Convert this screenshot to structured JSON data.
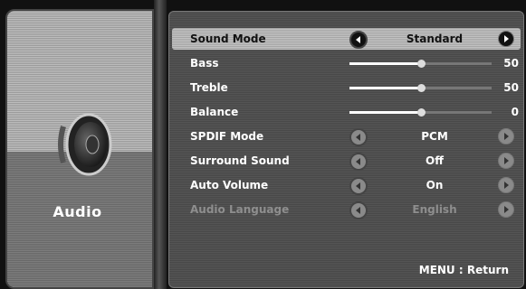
{
  "menu_title": "Audio",
  "footer": {
    "key": "MENU",
    "separator": ":",
    "action": "Return"
  },
  "settings": [
    {
      "label": "Sound Mode",
      "value": "Standard"
    },
    {
      "label": "Bass",
      "value": "50",
      "level": 0.5
    },
    {
      "label": "Treble",
      "value": "50",
      "level": 0.5
    },
    {
      "label": "Balance",
      "value": "0",
      "level": 0.5
    },
    {
      "label": "SPDIF Mode",
      "value": "PCM"
    },
    {
      "label": "Surround Sound",
      "value": "Off"
    },
    {
      "label": "Auto Volume",
      "value": "On"
    },
    {
      "label": "Audio Language",
      "value": "English"
    }
  ]
}
